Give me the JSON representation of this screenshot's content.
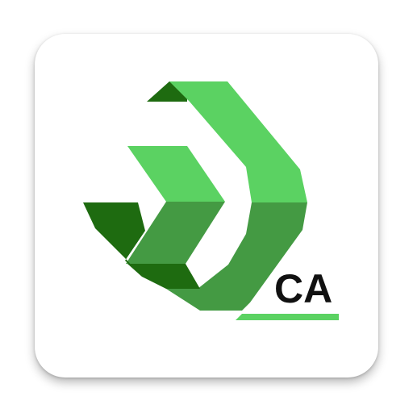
{
  "app_icon": {
    "badge_text": "CA",
    "icon_name": "green-chevron-logo-icon",
    "colors": {
      "tile_background": "#ffffff",
      "light_green": "#5bd262",
      "mid_green": "#449a43",
      "dark_green": "#1e6b10",
      "text": "#111111"
    }
  }
}
